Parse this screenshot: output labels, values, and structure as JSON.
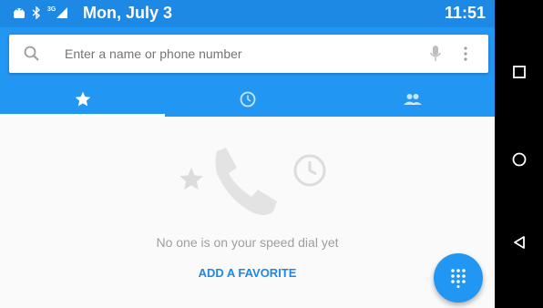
{
  "status_bar": {
    "date": "Mon, July 3",
    "time": "11:51",
    "network_label": "3G",
    "icons": [
      "android-icon",
      "bluetooth-icon",
      "signal-icon"
    ]
  },
  "search": {
    "placeholder": "Enter a name or phone number"
  },
  "tabs": [
    {
      "icon": "star-icon",
      "selected": true
    },
    {
      "icon": "clock-icon",
      "selected": false
    },
    {
      "icon": "people-icon",
      "selected": false
    }
  ],
  "speed_dial": {
    "empty_message": "No one is on your speed dial yet",
    "add_favorite_label": "ADD A FAVORITE"
  },
  "nav_bar": {
    "buttons": [
      "recents-icon",
      "home-icon",
      "back-icon"
    ]
  },
  "colors": {
    "primary": "#2196F3",
    "status_bar": "#1E88E5",
    "accent_text": "#1E88E5",
    "background": "#FAFAFA"
  }
}
